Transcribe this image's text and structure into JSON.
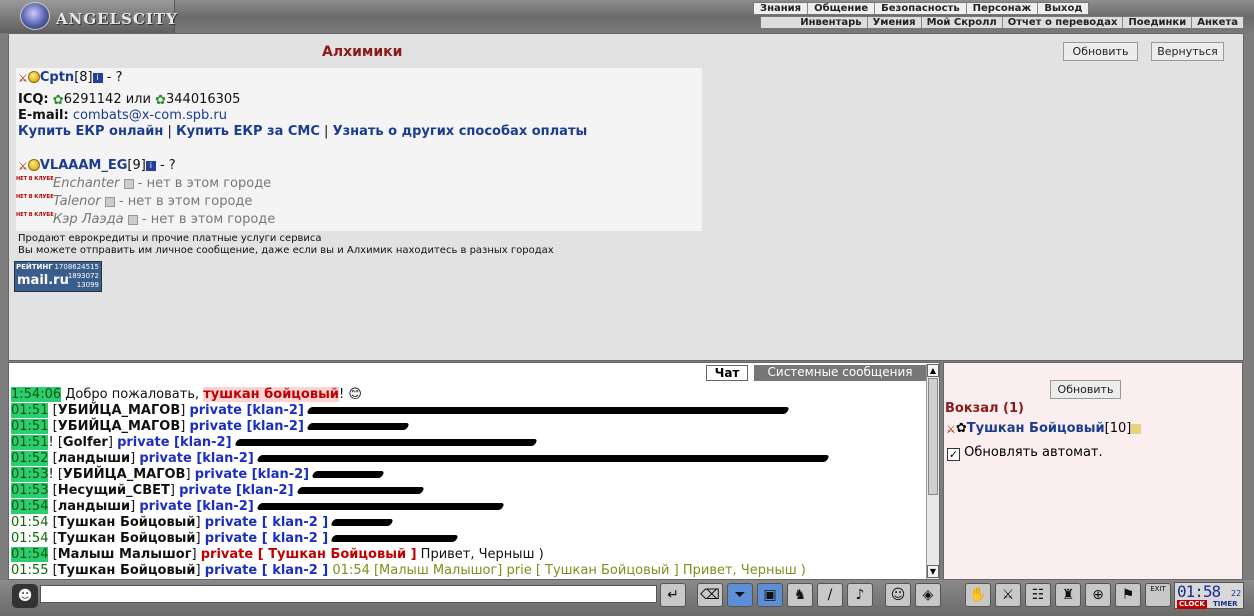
{
  "app": {
    "logo_title": "ANGELSCITY"
  },
  "menu_main": [
    "Знания",
    "Общение",
    "Безопасность",
    "Персонаж",
    "Выход"
  ],
  "menu_sub": [
    "Инвентарь",
    "Умения",
    "Мой Скролл",
    "Отчет о переводах",
    "Поединки",
    "Анкета"
  ],
  "page": {
    "title": "Алхимики",
    "refresh_label": "Обновить",
    "back_label": "Вернуться"
  },
  "alchemists": {
    "one": {
      "name": "Cptn",
      "level": "[8]",
      "status": "- ?"
    },
    "icq_label": "ICQ:",
    "icq1": "6291142",
    "icq_or": "или",
    "icq2": "344016305",
    "email_label": "E-mail:",
    "email": "combats@x-com.spb.ru",
    "buy_online": "Купить ЕКР онлайн",
    "buy_sms": "Купить ЕКР за СМС",
    "other_methods": "Узнать о других способах оплаты",
    "two": {
      "name": "VLAAAM_EG",
      "level": "[9]",
      "status": "- ?"
    },
    "offline": [
      {
        "name": "Enchanter",
        "status": "- нет в этом городе"
      },
      {
        "name": "Talenor",
        "status": "- нет в этом городе"
      },
      {
        "name": "Кэр Лаэда",
        "status": "- нет в этом городе"
      }
    ],
    "offline_badge": "НЕТ В КЛУБЕ"
  },
  "notes": {
    "line1": "Продают еврокредиты и прочие платные услуги сервиса",
    "line2": "Вы можете отправить им личное сообщение, даже если вы и Алхимик находитесь в разных городах"
  },
  "counter": {
    "label": "РЕЙТИНГ",
    "n1": "1708624515",
    "n2": "1893072",
    "n3": "13099",
    "brand": "mail.ru"
  },
  "chat": {
    "tab_chat": "Чат",
    "tab_system": "Системные сообщения",
    "welcome": {
      "time": "1:54:06",
      "text": "Добро пожаловать,",
      "name": "тушкан бойцовый",
      "end": "!"
    },
    "lines": [
      {
        "time": "01:51",
        "nick": "УБИЙЦА_МАГОВ",
        "pv": "private [klan-2]",
        "prefix": "",
        "hl": true
      },
      {
        "time": "01:51",
        "nick": "УБИЙЦА_МАГОВ",
        "pv": "private [klan-2]",
        "prefix": "",
        "hl": true
      },
      {
        "time": "01:51",
        "nick": "Golfer",
        "pv": "private [klan-2]",
        "prefix": "!",
        "hl": true
      },
      {
        "time": "01:52",
        "nick": "ландыши",
        "pv": "private [klan-2]",
        "prefix": "",
        "hl": true
      },
      {
        "time": "01:53",
        "nick": "УБИЙЦА_МАГОВ",
        "pv": "private [klan-2]",
        "prefix": "!",
        "hl": true
      },
      {
        "time": "01:53",
        "nick": "Несущий_СВЕТ",
        "pv": "private [klan-2]",
        "prefix": "",
        "hl": true
      },
      {
        "time": "01:54",
        "nick": "ландыши",
        "pv": "private [klan-2]",
        "prefix": "",
        "hl": true
      },
      {
        "time": "01:54",
        "nick": "Тушкан Бойцовый",
        "pv": "private [ klan-2 ]",
        "prefix": "",
        "hl": false
      },
      {
        "time": "01:54",
        "nick": "Тушкан Бойцовый",
        "pv": "private [ klan-2 ]",
        "prefix": "",
        "hl": false
      }
    ],
    "msg_malysh": {
      "time": "01:54",
      "nick": "Малыш Малышог",
      "pv": "private [ Тушкан Бойцовый ]",
      "text": "Привет, Черныш )"
    },
    "msg_last": {
      "time": "01:55",
      "nick": "Тушкан Бойцовый",
      "pv": "private [ klan-2 ]",
      "echo": "01:54 [Малыш Малышог] prie [ Тушкан Бойцовый ] Привет, Черныш )"
    }
  },
  "room": {
    "refresh_label": "Обновить",
    "title": "Вокзал (1)",
    "user": {
      "name": "Тушкан Бойцовый",
      "level": "[10]"
    },
    "auto_label": "Обновлять автомат."
  },
  "clock": {
    "time": "01:58",
    "sec": "22",
    "clock_label": "CLOCK",
    "timer_label": "TIMER",
    "exit_label": "EXIT"
  },
  "colors": {
    "accent": "#8b1a1a",
    "link": "#1b3d8f",
    "private": "#1a2fbf",
    "time_highlight": "#2ecc71"
  }
}
